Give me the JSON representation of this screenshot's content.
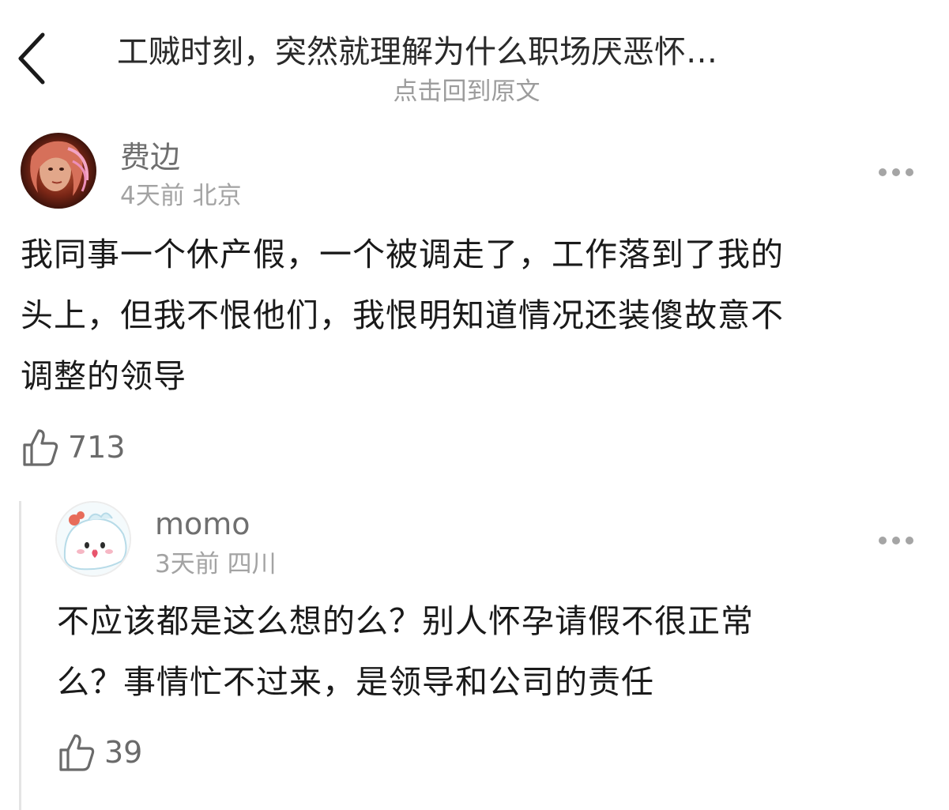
{
  "header": {
    "title": "工贼时刻，突然就理解为什么职场厌恶怀…",
    "subtitle": "点击回到原文"
  },
  "comments": [
    {
      "username": "费边",
      "meta": "4天前 北京",
      "text_lines": [
        "我同事一个休产假，一个被调走了，工作落到了我的",
        "头上，但我不恨他们，我恨明知道情况还装傻故意不",
        "调整的领导"
      ],
      "likes": "713"
    },
    {
      "username": "momo",
      "meta": "3天前 四川",
      "text_lines": [
        "不应该都是这么想的么？别人怀孕请假不很正常",
        "么？事情忙不过来，是领导和公司的责任"
      ],
      "likes": "39"
    }
  ],
  "icons": {
    "back": "back-chevron-icon",
    "more": "more-dots-icon",
    "like": "thumbs-up-icon"
  }
}
